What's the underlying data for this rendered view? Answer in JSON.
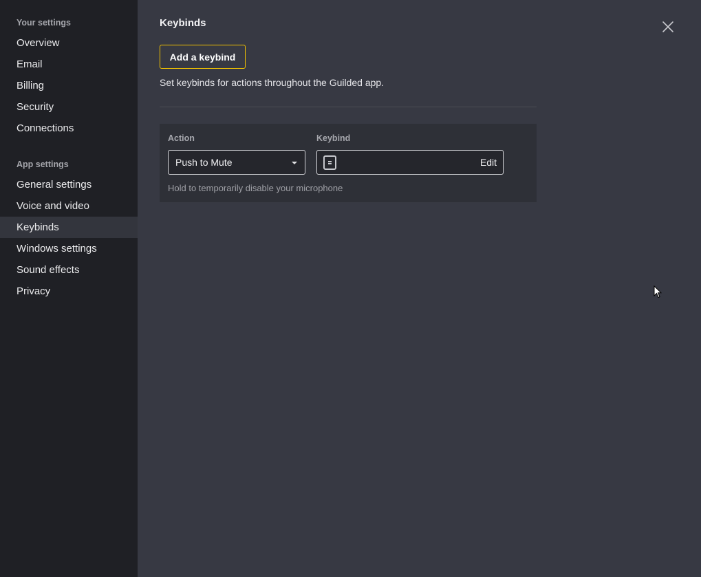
{
  "sidebar": {
    "your_settings_header": "Your settings",
    "your_settings": [
      {
        "label": "Overview"
      },
      {
        "label": "Email"
      },
      {
        "label": "Billing"
      },
      {
        "label": "Security"
      },
      {
        "label": "Connections"
      }
    ],
    "app_settings_header": "App settings",
    "app_settings": [
      {
        "label": "General settings"
      },
      {
        "label": "Voice and video"
      },
      {
        "label": "Keybinds",
        "active": true
      },
      {
        "label": "Windows settings"
      },
      {
        "label": "Sound effects"
      },
      {
        "label": "Privacy"
      }
    ]
  },
  "main": {
    "title": "Keybinds",
    "add_button": "Add a keybind",
    "description": "Set keybinds for actions throughout the Guilded app.",
    "card": {
      "action_label": "Action",
      "keybind_label": "Keybind",
      "action_value": "Push to Mute",
      "keybind_value": "",
      "edit_label": "Edit",
      "hint": "Hold to temporarily disable your microphone"
    }
  },
  "icons": {
    "close": "close-icon",
    "dropdown": "chevron-down-icon",
    "key": "keyboard-key-icon",
    "cursor": "mouse-cursor-icon"
  },
  "colors": {
    "sidebar_bg": "#1f2025",
    "main_bg": "#373943",
    "card_bg": "#2e3037",
    "accent": "#f5c400"
  }
}
